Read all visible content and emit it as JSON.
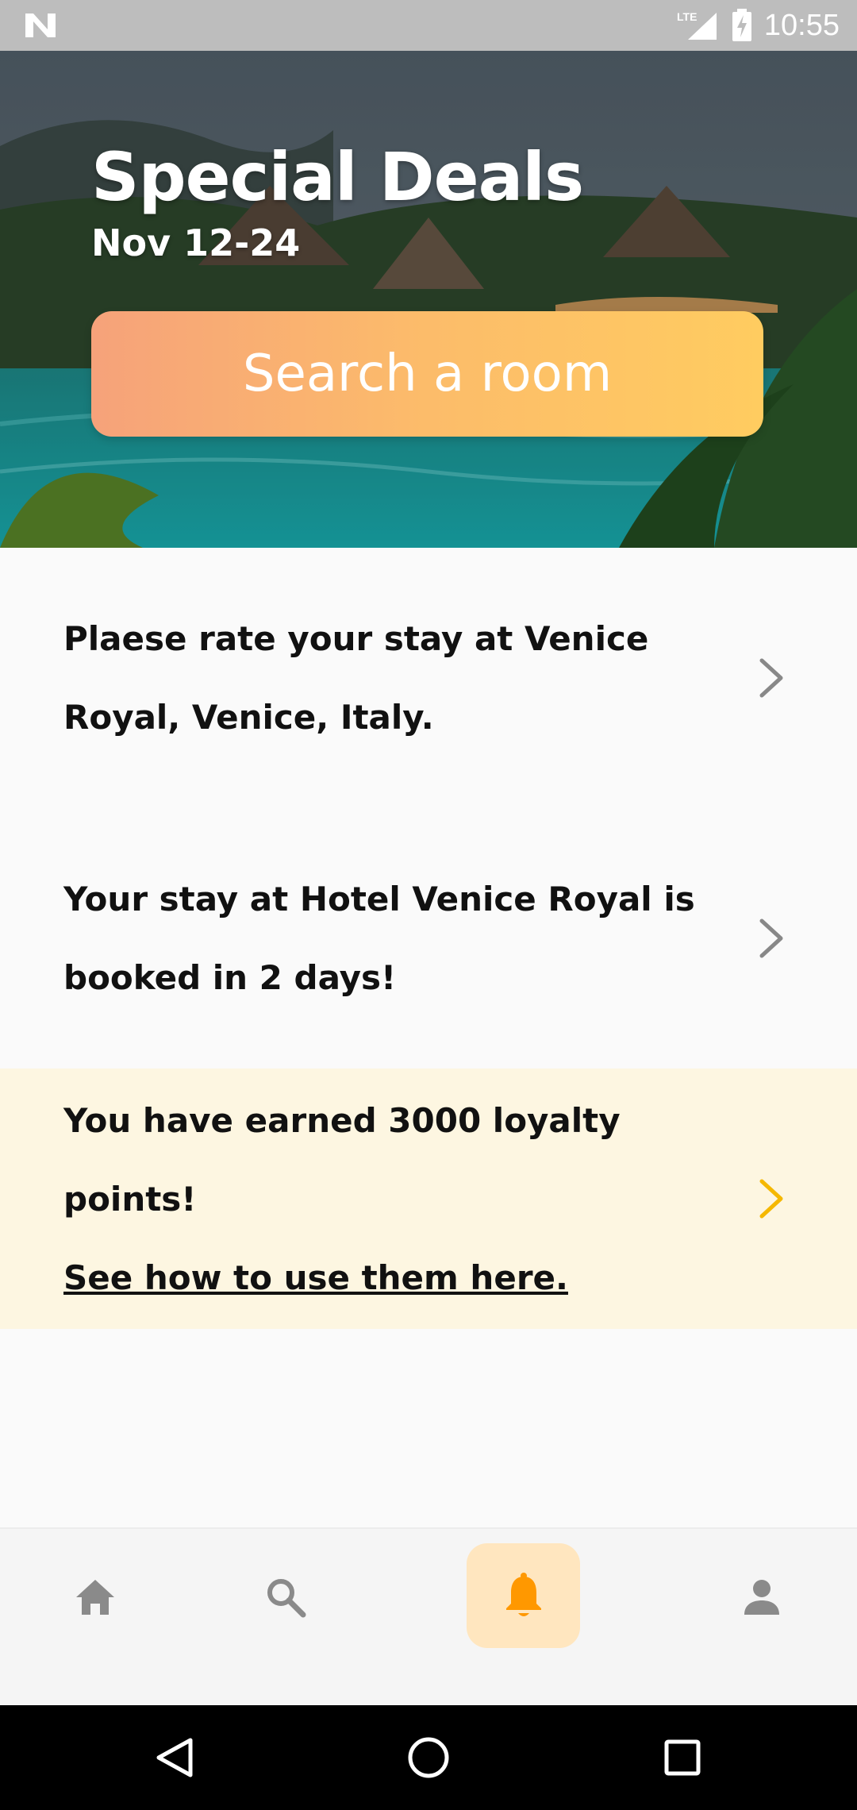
{
  "status_bar": {
    "network_label": "LTE",
    "time": "10:55"
  },
  "hero": {
    "title": "Special Deals",
    "dates": "Nov 12-24",
    "search_button_label": "Search a room"
  },
  "notifications": [
    {
      "lines": [
        "Plaese rate your stay at Venice",
        "Royal, Venice, Italy."
      ],
      "highlighted": false
    },
    {
      "lines": [
        "Your stay at Hotel Venice Royal is",
        "booked in 2 days!"
      ],
      "highlighted": false
    },
    {
      "lines": [
        "You have earned 3000 loyalty points!"
      ],
      "link_text": "See how to use them here.",
      "highlighted": true
    }
  ],
  "bottom_nav": {
    "items": [
      {
        "icon": "home-icon",
        "active": false
      },
      {
        "icon": "search-icon",
        "active": false
      },
      {
        "icon": "bell-icon",
        "active": true
      },
      {
        "icon": "person-icon",
        "active": false
      }
    ]
  },
  "colors": {
    "accent": "#ff9800",
    "accent_soft": "#ffe6bf",
    "highlight_row": "#fdf6e1",
    "chevron_default": "#888888",
    "chevron_highlight": "#f5b800",
    "search_gradient_start": "#f6a27a",
    "search_gradient_end": "#ffcc60"
  }
}
